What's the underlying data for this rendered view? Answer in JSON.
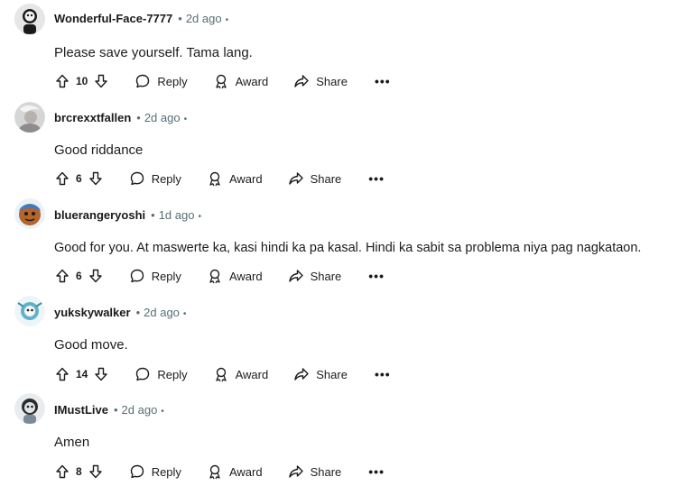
{
  "comments": [
    {
      "username": "Wonderful-Face-7777",
      "time": "2d ago",
      "text": "Please save yourself. Tama lang.",
      "score": "10",
      "reply": "Reply",
      "award": "Award",
      "share": "Share",
      "more": "•••",
      "avatar_color": "#d9d9d9"
    },
    {
      "username": "brcrexxtfallen",
      "time": "2d ago",
      "text": "Good riddance",
      "score": "6",
      "reply": "Reply",
      "award": "Award",
      "share": "Share",
      "more": "•••",
      "avatar_color": "#c9c9c9"
    },
    {
      "username": "bluerangeryoshi",
      "time": "1d ago",
      "text": "Good for you. At maswerte ka, kasi hindi ka pa kasal. Hindi ka sabit sa problema niya pag nagkataon.",
      "score": "6",
      "reply": "Reply",
      "award": "Award",
      "share": "Share",
      "more": "•••",
      "avatar_color": "#3a86c8"
    },
    {
      "username": "yukskywalker",
      "time": "2d ago",
      "text": "Good move.",
      "score": "14",
      "reply": "Reply",
      "award": "Award",
      "share": "Share",
      "more": "•••",
      "avatar_color": "#e8f1f7"
    },
    {
      "username": "IMustLive",
      "time": "2d ago",
      "text": "Amen",
      "score": "8",
      "reply": "Reply",
      "award": "Award",
      "share": "Share",
      "more": "•••",
      "avatar_color": "#e3e6ea"
    }
  ]
}
